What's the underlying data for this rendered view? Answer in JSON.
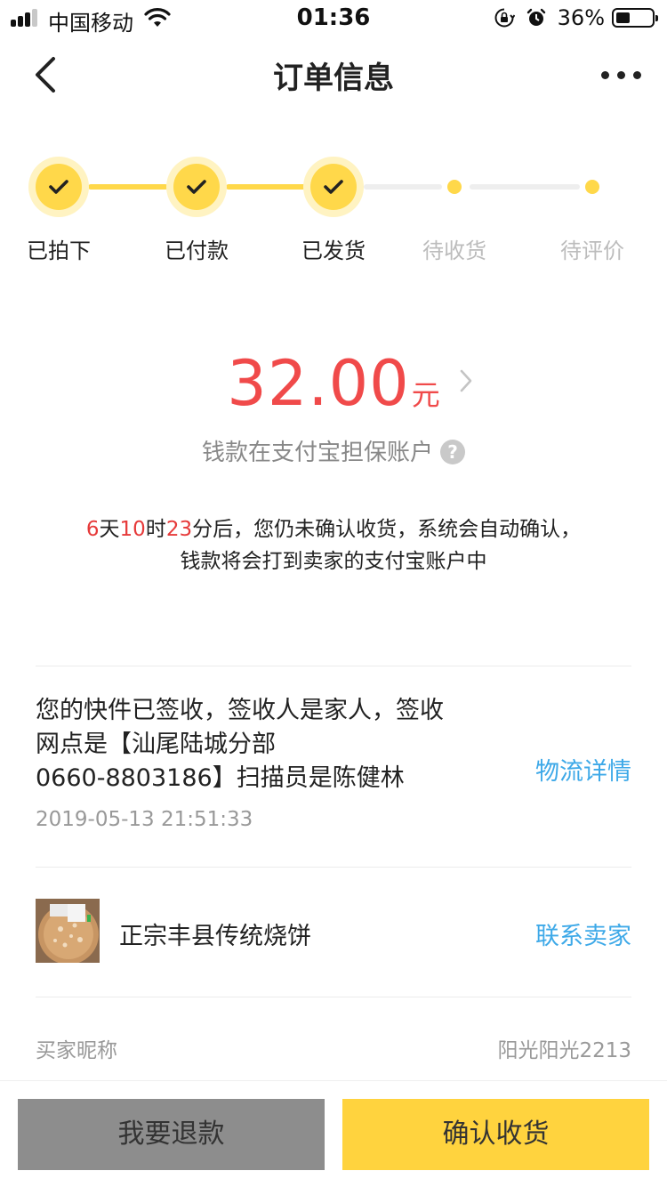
{
  "status_bar": {
    "carrier": "中国移动",
    "time": "01:36",
    "battery_percent": "36%"
  },
  "nav": {
    "title": "订单信息"
  },
  "progress": {
    "steps": [
      {
        "label": "已拍下",
        "state": "done"
      },
      {
        "label": "已付款",
        "state": "done"
      },
      {
        "label": "已发货",
        "state": "done"
      },
      {
        "label": "待收货",
        "state": "pending"
      },
      {
        "label": "待评价",
        "state": "pending"
      }
    ]
  },
  "payment": {
    "amount": "32.00",
    "currency": "元",
    "escrow_text": "钱款在支付宝担保账户",
    "help_glyph": "?"
  },
  "notice": {
    "days": "6",
    "days_unit": "天",
    "hours": "10",
    "hours_unit": "时",
    "minutes": "23",
    "text": "分后，您仍未确认收货，系统会自动确认，钱款将会打到卖家的支付宝账户中"
  },
  "logistics": {
    "line1": "您的快件已签收，签收人是家人，签收",
    "line2": "网点是【汕尾陆城分部",
    "line3": "0660-8803186】扫描员是陈健林",
    "time": "2019-05-13 21:51:33",
    "detail_link": "物流详情"
  },
  "product": {
    "name": "正宗丰县传统烧饼",
    "contact_seller": "联系卖家"
  },
  "buyer": {
    "label": "买家昵称",
    "value": "阳光阳光2213"
  },
  "actions": {
    "refund": "我要退款",
    "confirm": "确认收货"
  },
  "colors": {
    "accent_yellow": "#ffd84a",
    "price_red": "#f04a4a",
    "link_blue": "#3ea9e8"
  }
}
